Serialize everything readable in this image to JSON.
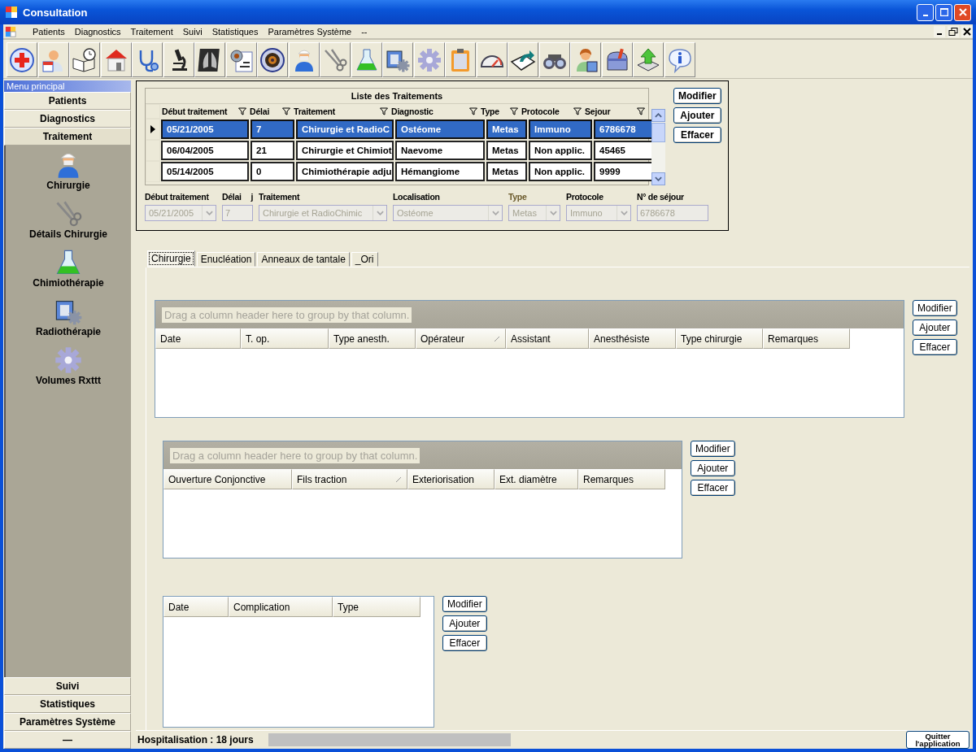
{
  "window": {
    "title": "Consultation"
  },
  "menu": [
    "Patients",
    "Diagnostics",
    "Traitement",
    "Suivi",
    "Statistiques",
    "Paramètres Système",
    "--"
  ],
  "sidebar": {
    "header": "Menu principal",
    "sections": [
      {
        "label": "Patients",
        "expanded": false
      },
      {
        "label": "Diagnostics",
        "expanded": false
      },
      {
        "label": "Traitement",
        "expanded": true,
        "items": [
          "Chirurgie",
          "Détails Chirurgie",
          "Chimiothérapie",
          "Radiothérapie",
          "Volumes Rxttt"
        ]
      },
      {
        "label": "Suivi",
        "expanded": false
      },
      {
        "label": "Statistiques",
        "expanded": false
      },
      {
        "label": "Paramètres Système",
        "expanded": false
      },
      {
        "label": "—",
        "expanded": false
      }
    ]
  },
  "treatments": {
    "title": "Liste des Traitements",
    "columns": [
      "Début traitement",
      "Délai",
      "Traitement",
      "Diagnostic",
      "Type",
      "Protocole",
      "Sejour"
    ],
    "rows": [
      {
        "selected": true,
        "cells": [
          "05/21/2005",
          "7",
          "Chirurgie et RadioC",
          "Ostéome",
          "Metas",
          "Immuno",
          "6786678"
        ]
      },
      {
        "selected": false,
        "cells": [
          "06/04/2005",
          "21",
          "Chirurgie et Chimiot",
          "Naevome",
          "Metas",
          "Non applic.",
          "45465"
        ]
      },
      {
        "selected": false,
        "cells": [
          "05/14/2005",
          "0",
          "Chimiothérapie adju",
          "Hémangiome",
          "Metas",
          "Non applic.",
          "9999"
        ]
      }
    ],
    "buttons": [
      "Modifier",
      "Ajouter",
      "Effacer"
    ]
  },
  "details": [
    {
      "label": "Début traitement",
      "value": "05/21/2005",
      "kind": "combo",
      "disabled": true
    },
    {
      "label": "Délai",
      "unit": "j",
      "value": "7",
      "kind": "text",
      "disabled": true
    },
    {
      "label": "Traitement",
      "value": "Chirurgie et RadioChimic",
      "kind": "combo",
      "disabled": true
    },
    {
      "label": "Localisation",
      "value": "Ostéome",
      "kind": "combo",
      "disabled": true
    },
    {
      "label": "Type",
      "label_muted": true,
      "value": "Metas",
      "kind": "combo",
      "disabled": true
    },
    {
      "label": "Protocole",
      "value": "Immuno",
      "kind": "combo",
      "disabled": true
    },
    {
      "label": "N° de séjour",
      "value": "6786678",
      "kind": "text",
      "disabled": true
    }
  ],
  "tabs": [
    {
      "label": "Chirurgie",
      "selected": true
    },
    {
      "label": "Enucléation",
      "selected": false
    },
    {
      "label": "Anneaux de tantale",
      "selected": false
    },
    {
      "label": "_Ori",
      "selected": false
    }
  ],
  "grids": [
    {
      "group_hint": "Drag a column header here to group by that column.",
      "columns": [
        {
          "label": "Date",
          "sorted": false
        },
        {
          "label": "T. op.",
          "sorted": false
        },
        {
          "label": "Type anesth.",
          "sorted": false
        },
        {
          "label": "Opérateur",
          "sorted": true
        },
        {
          "label": "Assistant",
          "sorted": false
        },
        {
          "label": "Anesthésiste",
          "sorted": false
        },
        {
          "label": "Type chirurgie",
          "sorted": false
        },
        {
          "label": "Remarques",
          "sorted": false
        }
      ],
      "buttons": [
        "Modifier",
        "Ajouter",
        "Effacer"
      ]
    },
    {
      "group_hint": "Drag a column header here to group by that column.",
      "columns": [
        {
          "label": "Ouverture Conjonctive",
          "sorted": false
        },
        {
          "label": "Fils traction",
          "sorted": true
        },
        {
          "label": "Exteriorisation",
          "sorted": false
        },
        {
          "label": "Ext. diamètre",
          "sorted": false
        },
        {
          "label": "Remarques",
          "sorted": false
        }
      ],
      "buttons": [
        "Modifier",
        "Ajouter",
        "Effacer"
      ]
    },
    {
      "columns": [
        {
          "label": "Date",
          "sorted": false
        },
        {
          "label": "Complication",
          "sorted": false
        },
        {
          "label": "Type",
          "sorted": false
        }
      ],
      "buttons": [
        "Modifier",
        "Ajouter",
        "Effacer"
      ]
    }
  ],
  "status_bar": {
    "text": "Hospitalisation : 18 jours",
    "quit_button": "Quitter l'application"
  }
}
